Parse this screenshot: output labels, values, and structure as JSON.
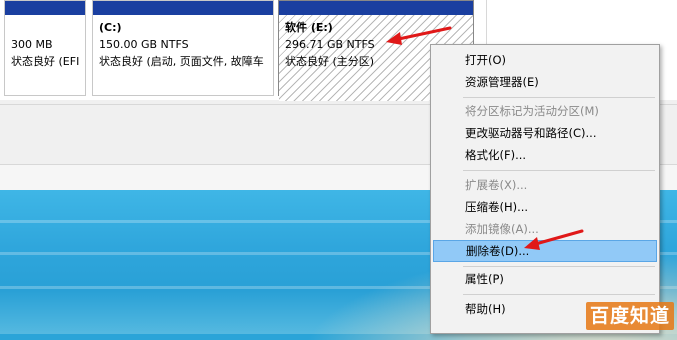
{
  "partitions": [
    {
      "title": "",
      "size": "300 MB",
      "status": "状态良好 (EFI"
    },
    {
      "title": "(C:)",
      "size": "150.00 GB NTFS",
      "status": "状态良好 (启动, 页面文件, 故障车"
    },
    {
      "title": "软件  (E:)",
      "size": "296.71 GB NTFS",
      "status": "状态良好 (主分区)"
    }
  ],
  "context_menu": {
    "items": [
      {
        "label": "打开(O)",
        "enabled": true
      },
      {
        "label": "资源管理器(E)",
        "enabled": true
      },
      {
        "label": "将分区标记为活动分区(M)",
        "enabled": false
      },
      {
        "label": "更改驱动器号和路径(C)...",
        "enabled": true
      },
      {
        "label": "格式化(F)...",
        "enabled": true
      },
      {
        "label": "扩展卷(X)...",
        "enabled": false
      },
      {
        "label": "压缩卷(H)...",
        "enabled": true
      },
      {
        "label": "添加镜像(A)...",
        "enabled": false
      },
      {
        "label": "删除卷(D)...",
        "enabled": true,
        "highlighted": true
      },
      {
        "label": "属性(P)",
        "enabled": true
      },
      {
        "label": "帮助(H)",
        "enabled": true
      }
    ]
  },
  "watermark": "百度知道",
  "colors": {
    "partition_header": "#1a3fa0",
    "menu_highlight": "#91c9f7",
    "annotation_arrow": "#e01818"
  }
}
